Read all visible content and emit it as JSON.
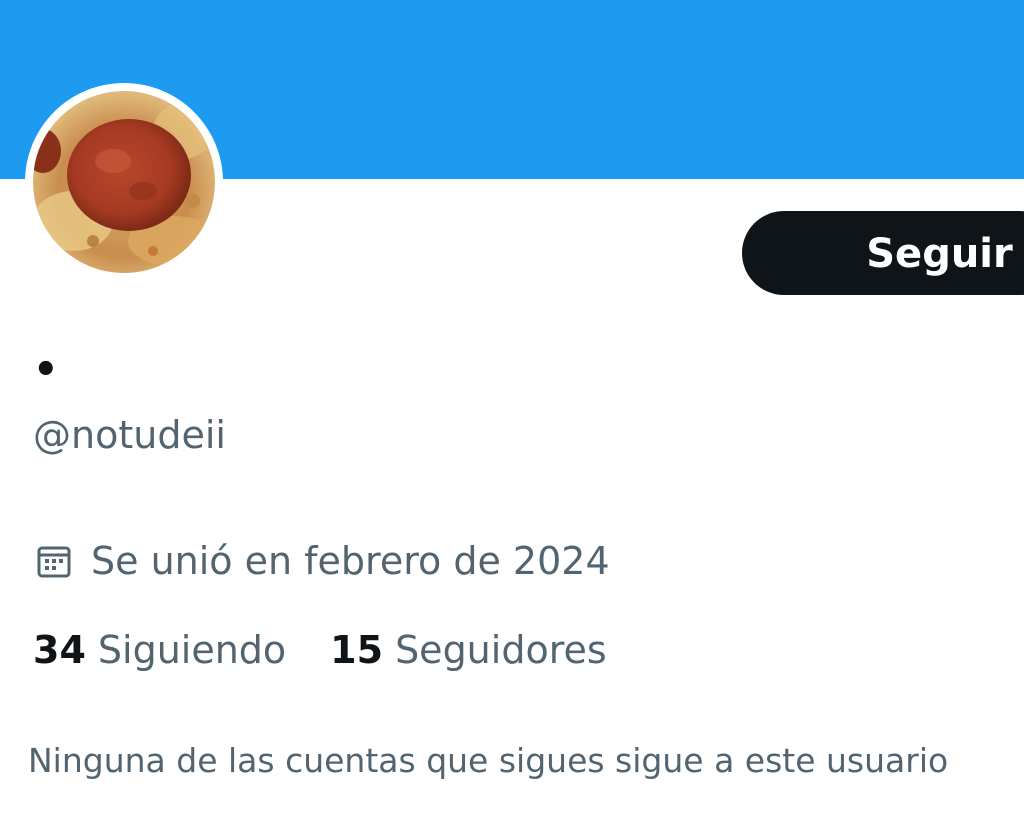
{
  "colors": {
    "banner": "#1d9bf0",
    "follow_bg": "#0f1419",
    "secondary_text": "#536471"
  },
  "profile": {
    "display_name": "•",
    "handle": "@notudeii",
    "joined": "Se unió en febrero de 2024",
    "joined_icon": "calendar-icon",
    "follow_label": "Seguir"
  },
  "stats": {
    "following_count": "34",
    "following_label": "Siguiendo",
    "followers_count": "15",
    "followers_label": "Seguidores"
  },
  "mutuals_note": "Ninguna de las cuentas que sigues sigue a este usuario"
}
